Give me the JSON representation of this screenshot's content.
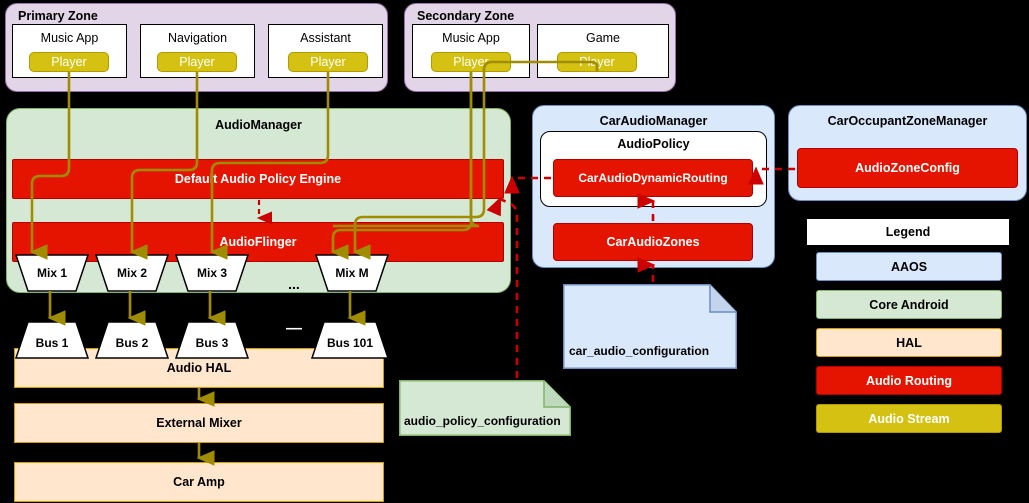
{
  "zones": [
    {
      "title": "Primary Zone",
      "apps": [
        {
          "name": "Music App",
          "player": "Player"
        },
        {
          "name": "Navigation",
          "player": "Player"
        },
        {
          "name": "Assistant",
          "player": "Player"
        }
      ]
    },
    {
      "title": "Secondary Zone",
      "apps": [
        {
          "name": "Music App",
          "player": "Player"
        },
        {
          "name": "Game",
          "player": "Player"
        }
      ]
    }
  ],
  "audio_manager": {
    "title": "AudioManager",
    "policy_engine": "Default Audio Policy Engine",
    "audio_flinger": "AudioFlinger",
    "mixes": [
      "Mix 1",
      "Mix 2",
      "Mix 3",
      "Mix M"
    ],
    "mix_ellipsis": "..."
  },
  "hal_stack": {
    "buses": [
      "Bus 1",
      "Bus 2",
      "Bus 3",
      "Bus 101"
    ],
    "bus_ellipsis": "—",
    "layers": [
      "Audio HAL",
      "External Mixer",
      "Car Amp"
    ]
  },
  "car_audio_manager": {
    "title": "CarAudioManager",
    "audio_policy_title": "AudioPolicy",
    "dynamic_routing": "CarAudioDynamicRouting",
    "car_audio_zones": "CarAudioZones"
  },
  "car_occupant_zone_manager": {
    "title": "CarOccupantZoneManager",
    "audio_zone_config": "AudioZoneConfig"
  },
  "notes": {
    "car_audio_configuration": "car_audio_configuration",
    "audio_policy_configuration": "audio_policy_configuration"
  },
  "legend": {
    "title": "Legend",
    "items": [
      {
        "label": "AAOS",
        "fill": "#dae8fc",
        "stroke": "#6c8ebf",
        "text": "#000000"
      },
      {
        "label": "Core Android",
        "fill": "#d5e8d4",
        "stroke": "#82b366",
        "text": "#000000"
      },
      {
        "label": "HAL",
        "fill": "#ffe6cc",
        "stroke": "#d79b00",
        "text": "#000000"
      },
      {
        "label": "Audio Routing",
        "fill": "#e51400",
        "stroke": "#b20000",
        "text": "#ffffff"
      },
      {
        "label": "Audio Stream",
        "fill": "#d4c111",
        "stroke": "#b09a00",
        "text": "#ffffff"
      }
    ]
  },
  "colors": {
    "audio_stream_line": "#a08c00",
    "audio_routing_line": "#cc0000",
    "zone_fill": "#e1d5e7",
    "core_android_fill": "#d5e8d4",
    "aaos_fill": "#dae8fc",
    "hal_fill": "#ffe6cc",
    "routing_fill": "#e51400",
    "stream_fill": "#d4c111"
  }
}
